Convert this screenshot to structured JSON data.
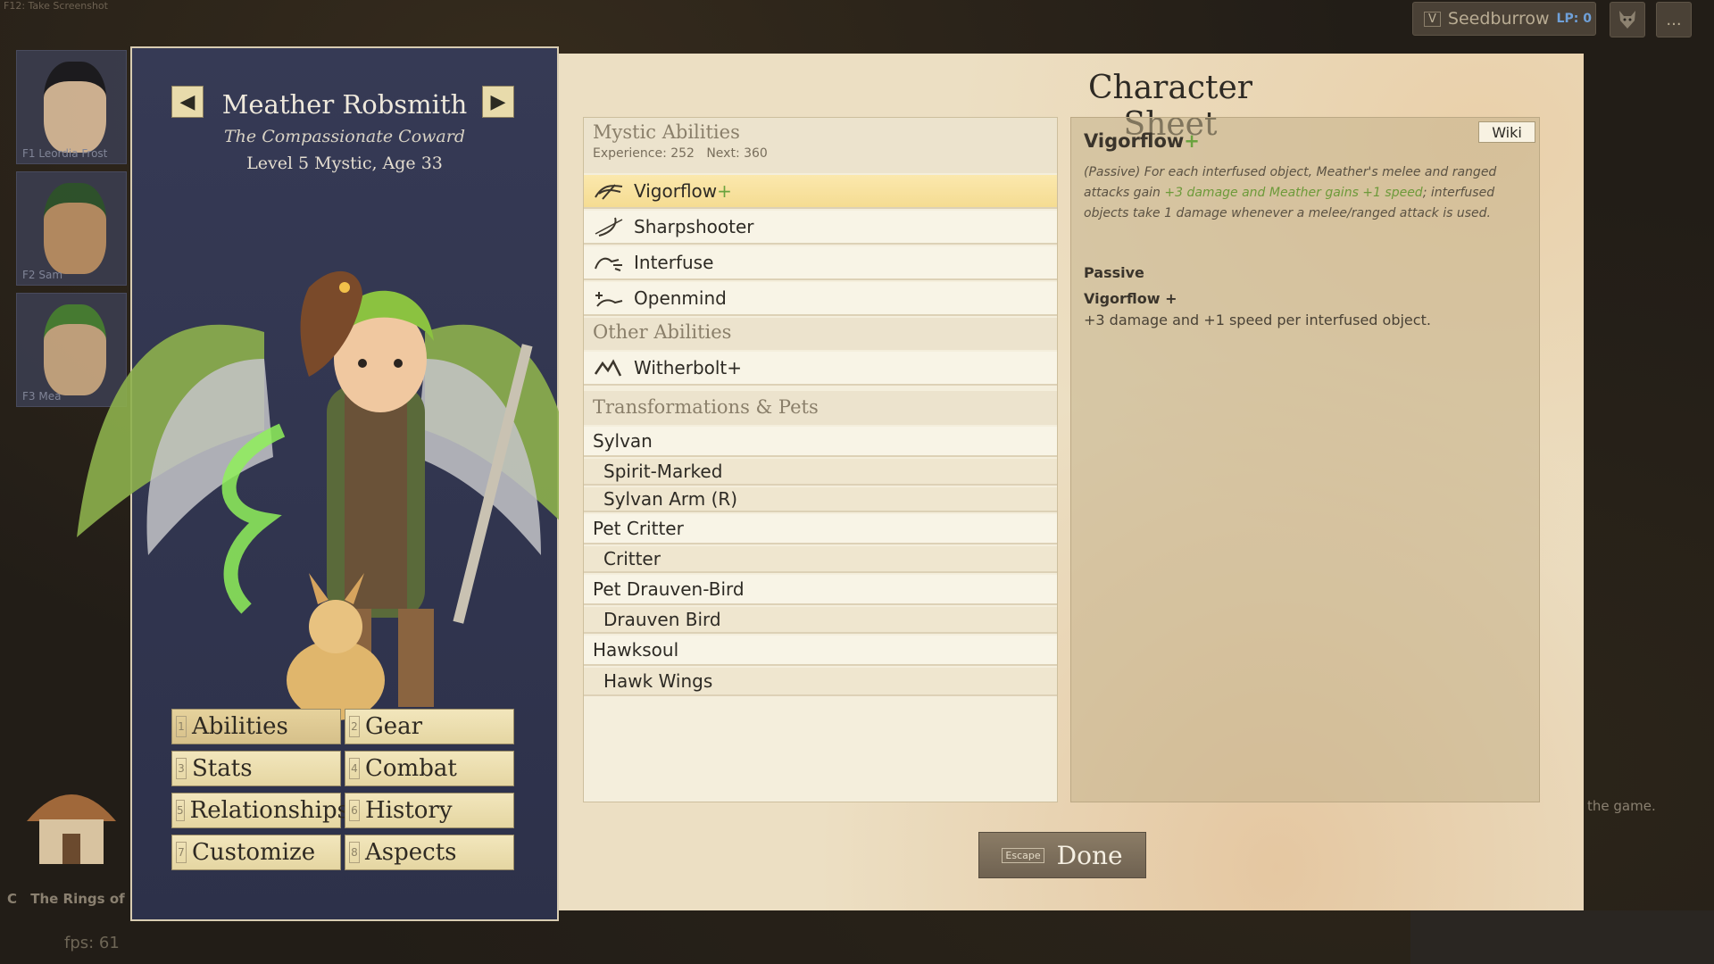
{
  "top_hint": "F12: Take Screenshot",
  "location": {
    "key": "V",
    "name": "Seedburrow",
    "lp_label": "LP: 0"
  },
  "top_icons": {
    "character": "wolf-head-icon",
    "menu": "..."
  },
  "party": [
    {
      "label": "F1 Leordia Frost"
    },
    {
      "label": "F2 Sam"
    },
    {
      "label": "F3 Mea"
    }
  ],
  "character": {
    "name": "Meather Robsmith",
    "title": "The Compassionate Coward",
    "level_line": "Level 5 Mystic, Age 33"
  },
  "tabs": [
    {
      "num": "1",
      "label": "Abilities",
      "active": true
    },
    {
      "num": "2",
      "label": "Gear"
    },
    {
      "num": "3",
      "label": "Stats"
    },
    {
      "num": "4",
      "label": "Combat"
    },
    {
      "num": "5",
      "label": "Relationships"
    },
    {
      "num": "6",
      "label": "History"
    },
    {
      "num": "7",
      "label": "Customize"
    },
    {
      "num": "8",
      "label": "Aspects"
    }
  ],
  "sheet": {
    "title": "Character Sheet",
    "mystic": {
      "header": "Mystic Abilities",
      "experience": "Experience: 252",
      "next": "Next: 360",
      "items": [
        {
          "label": "Vigorflow",
          "plus": "+",
          "icon": "vigorflow-icon",
          "selected": true
        },
        {
          "label": "Sharpshooter",
          "icon": "bow-icon"
        },
        {
          "label": "Interfuse",
          "icon": "interfuse-hand-icon"
        },
        {
          "label": "Openmind",
          "icon": "openmind-hand-icon"
        }
      ]
    },
    "other": {
      "header": "Other Abilities",
      "items": [
        {
          "label": "Witherbolt+",
          "icon": "witherbolt-icon"
        }
      ]
    },
    "transformations": {
      "header": "Transformations & Pets",
      "items": [
        {
          "label": "Sylvan",
          "sub": false
        },
        {
          "label": "Spirit-Marked",
          "sub": true
        },
        {
          "label": "Sylvan Arm (R)",
          "sub": true
        },
        {
          "label": "Pet Critter",
          "sub": false
        },
        {
          "label": "Critter",
          "sub": true
        },
        {
          "label": "Pet Drauven-Bird",
          "sub": false
        },
        {
          "label": "Drauven Bird",
          "sub": true
        },
        {
          "label": "Hawksoul",
          "sub": false
        },
        {
          "label": "Hawk Wings",
          "sub": true
        }
      ]
    },
    "detail": {
      "wiki": "Wiki",
      "title": "Vigorflow",
      "title_plus": "+",
      "desc_a": "(Passive) For each interfused object, Meather's melee and ranged attacks gain ",
      "desc_hl": "+3 damage and Meather gains +1 speed",
      "desc_b": "; interfused objects take 1 damage whenever a melee/ranged attack is used.",
      "passive_label": "Passive",
      "sub_title": "Vigorflow +",
      "sub_text": "+3 damage and +1 speed per interfused object."
    },
    "done": {
      "key": "Escape",
      "label": "Done"
    }
  },
  "background": {
    "rings_text": "The Rings of St",
    "rings_key": "C",
    "fps": "fps: 61",
    "game_text": "the game."
  }
}
